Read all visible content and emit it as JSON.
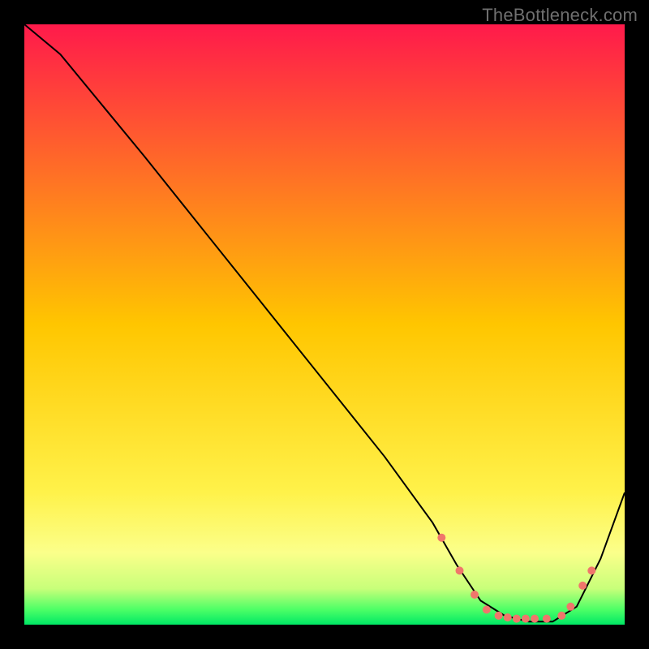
{
  "watermark": "TheBottleneck.com",
  "chart_data": {
    "type": "line",
    "title": "",
    "xlabel": "",
    "ylabel": "",
    "xlim": [
      0,
      100
    ],
    "ylim": [
      0,
      100
    ],
    "grid": false,
    "legend": false,
    "background_gradient": {
      "stops": [
        {
          "offset": 0.0,
          "color": "#ff1a4b"
        },
        {
          "offset": 0.5,
          "color": "#ffc600"
        },
        {
          "offset": 0.78,
          "color": "#fff24a"
        },
        {
          "offset": 0.88,
          "color": "#fbff8a"
        },
        {
          "offset": 0.94,
          "color": "#c8ff7a"
        },
        {
          "offset": 0.975,
          "color": "#4cff66"
        },
        {
          "offset": 1.0,
          "color": "#00e865"
        }
      ]
    },
    "series": [
      {
        "name": "bottleneck-curve",
        "color": "#000000",
        "x": [
          0,
          6,
          20,
          40,
          60,
          68,
          72,
          76,
          80,
          84,
          88,
          92,
          96,
          100
        ],
        "y": [
          100,
          95,
          78,
          53,
          28,
          17,
          10,
          4,
          1.5,
          0.5,
          0.5,
          3,
          11,
          22
        ]
      }
    ],
    "markers": {
      "name": "highlight-points",
      "color": "#f0766b",
      "radius": 5,
      "x": [
        69.5,
        72.5,
        75,
        77,
        79,
        80.5,
        82,
        83.5,
        85,
        87,
        89.5,
        91,
        93,
        94.5
      ],
      "y": [
        14.5,
        9,
        5,
        2.5,
        1.5,
        1.2,
        1.0,
        1.0,
        1.0,
        1.0,
        1.5,
        3,
        6.5,
        9
      ]
    }
  }
}
